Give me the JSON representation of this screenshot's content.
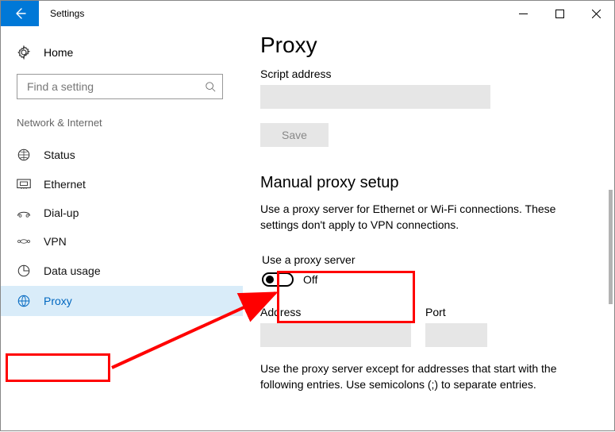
{
  "titlebar": {
    "title": "Settings"
  },
  "sidebar": {
    "home": "Home",
    "search_placeholder": "Find a setting",
    "category": "Network & Internet",
    "items": [
      {
        "label": "Status"
      },
      {
        "label": "Ethernet"
      },
      {
        "label": "Dial-up"
      },
      {
        "label": "VPN"
      },
      {
        "label": "Data usage"
      },
      {
        "label": "Proxy"
      }
    ]
  },
  "main": {
    "heading": "Proxy",
    "script_addr_label": "Script address",
    "save": "Save",
    "manual_heading": "Manual proxy setup",
    "manual_desc": "Use a proxy server for Ethernet or Wi-Fi connections. These settings don't apply to VPN connections.",
    "use_proxy_label": "Use a proxy server",
    "toggle_state": "Off",
    "address_label": "Address",
    "port_label": "Port",
    "except_desc": "Use the proxy server except for addresses that start with the following entries. Use semicolons (;) to separate entries."
  }
}
